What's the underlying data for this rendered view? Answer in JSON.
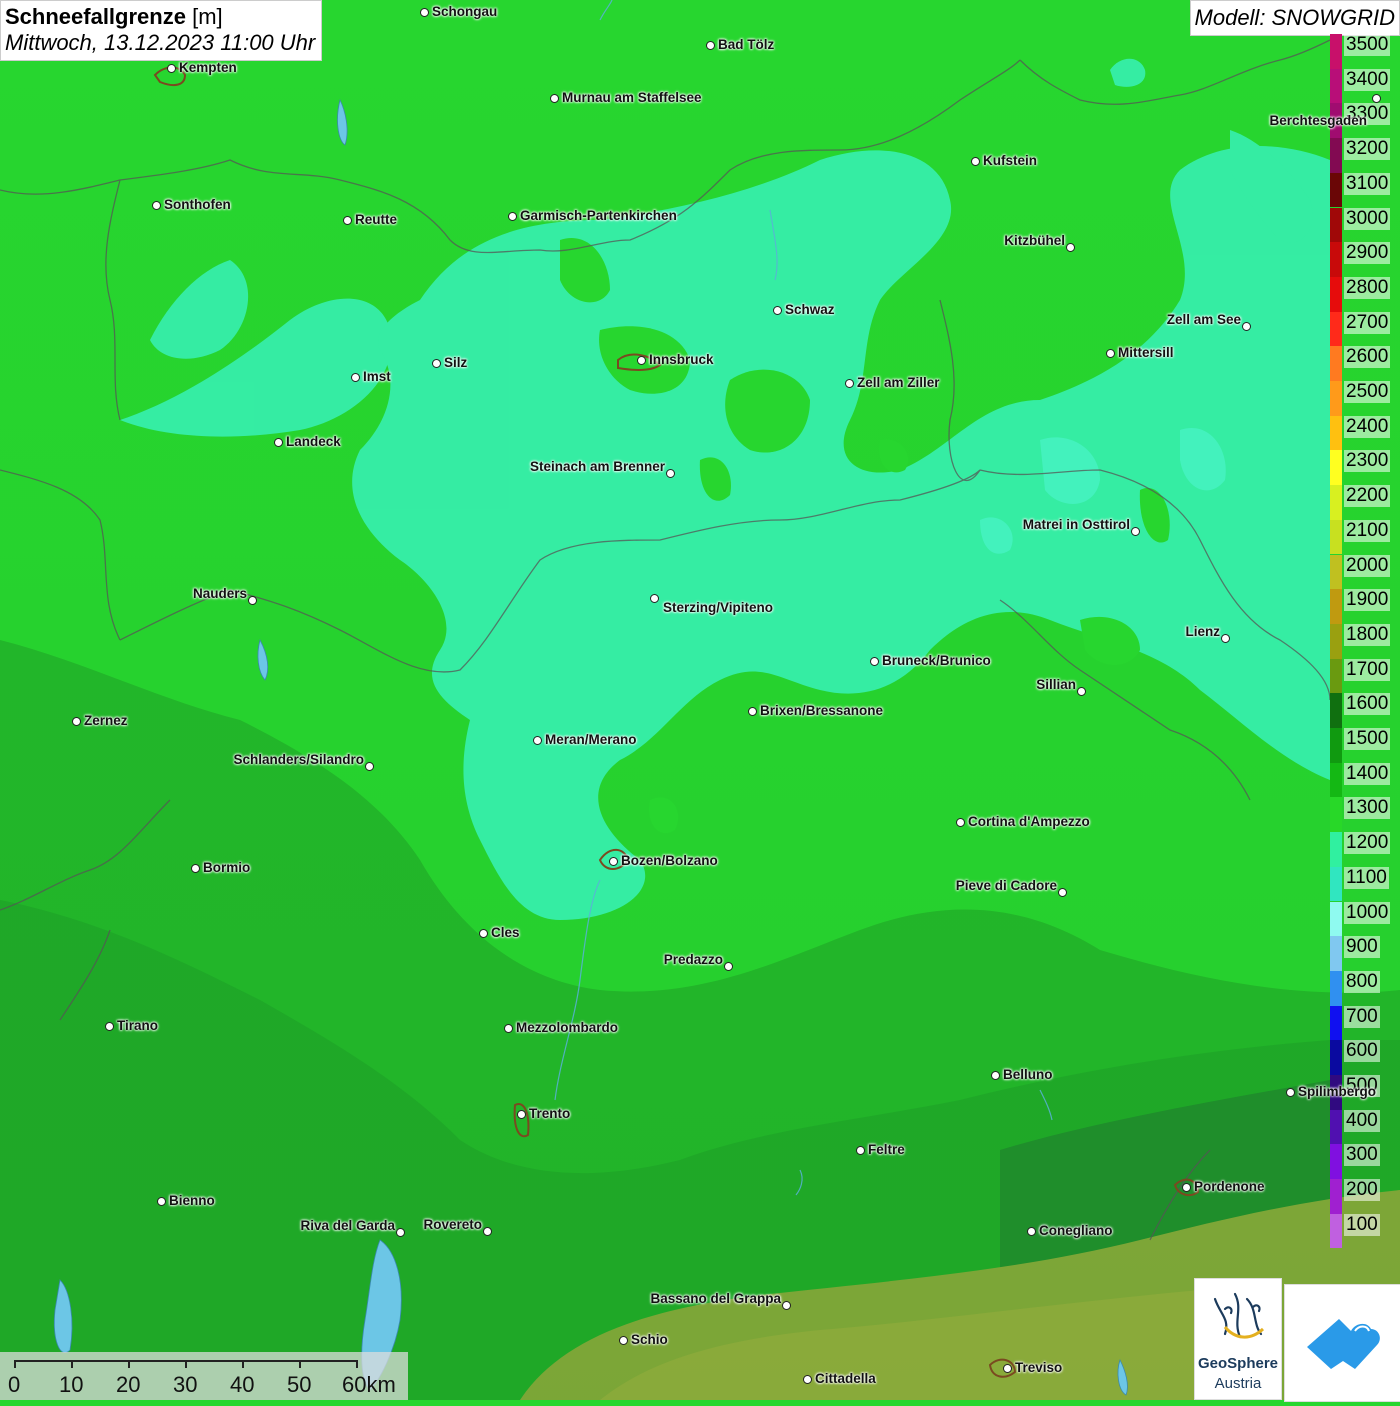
{
  "header": {
    "title_bold": "Schneefallgrenze",
    "title_unit": "[m]",
    "datetime": "Mittwoch, 13.12.2023 11:00 Uhr"
  },
  "model_label": "Modell: SNOWGRID",
  "legend": {
    "levels": [
      {
        "value": "3500",
        "color": "#c8106a"
      },
      {
        "value": "3400",
        "color": "#b80e78"
      },
      {
        "value": "3300",
        "color": "#a00c70"
      },
      {
        "value": "3200",
        "color": "#820a52"
      },
      {
        "value": "3100",
        "color": "#6a0606"
      },
      {
        "value": "3000",
        "color": "#a00808"
      },
      {
        "value": "2900",
        "color": "#c80a0a"
      },
      {
        "value": "2800",
        "color": "#e60c0c"
      },
      {
        "value": "2700",
        "color": "#ff2a1a"
      },
      {
        "value": "2600",
        "color": "#ff7a20"
      },
      {
        "value": "2500",
        "color": "#ff9a1a"
      },
      {
        "value": "2400",
        "color": "#ffc010"
      },
      {
        "value": "2300",
        "color": "#ffff20"
      },
      {
        "value": "2200",
        "color": "#d8f020"
      },
      {
        "value": "2100",
        "color": "#c8e020"
      },
      {
        "value": "2000",
        "color": "#c0c020"
      },
      {
        "value": "1900",
        "color": "#c09a10"
      },
      {
        "value": "1800",
        "color": "#9aa010"
      },
      {
        "value": "1700",
        "color": "#6a9a10"
      },
      {
        "value": "1600",
        "color": "#107010"
      },
      {
        "value": "1500",
        "color": "#109a10"
      },
      {
        "value": "1400",
        "color": "#14b814"
      },
      {
        "value": "1300",
        "color": "#28d828"
      },
      {
        "value": "1200",
        "color": "#30f0a0"
      },
      {
        "value": "1100",
        "color": "#30e6c0"
      },
      {
        "value": "1000",
        "color": "#8ffaf0"
      },
      {
        "value": "900",
        "color": "#80c8f0"
      },
      {
        "value": "800",
        "color": "#3090f0"
      },
      {
        "value": "700",
        "color": "#1010f0"
      },
      {
        "value": "600",
        "color": "#0a0aa0"
      },
      {
        "value": "500",
        "color": "#300a80"
      },
      {
        "value": "400",
        "color": "#5010b0"
      },
      {
        "value": "300",
        "color": "#8010e0"
      },
      {
        "value": "200",
        "color": "#a020d0"
      },
      {
        "value": "100",
        "color": "#c060e0"
      }
    ]
  },
  "cities": [
    {
      "name": "Schongau"
    },
    {
      "name": "Kempten"
    },
    {
      "name": "Bad Tölz"
    },
    {
      "name": "Murnau am Staffelsee"
    },
    {
      "name": "Berchtesgaden"
    },
    {
      "name": "Kufstein"
    },
    {
      "name": "Sonthofen"
    },
    {
      "name": "Reutte"
    },
    {
      "name": "Garmisch-Partenkirchen"
    },
    {
      "name": "Kitzbühel"
    },
    {
      "name": "Schwaz"
    },
    {
      "name": "Zell am See"
    },
    {
      "name": "Mittersill"
    },
    {
      "name": "Innsbruck"
    },
    {
      "name": "Imst"
    },
    {
      "name": "Silz"
    },
    {
      "name": "Zell am Ziller"
    },
    {
      "name": "Landeck"
    },
    {
      "name": "Steinach am Brenner"
    },
    {
      "name": "Matrei in Osttirol"
    },
    {
      "name": "Nauders"
    },
    {
      "name": "Sterzing/Vipiteno"
    },
    {
      "name": "Lienz"
    },
    {
      "name": "Bruneck/Brunico"
    },
    {
      "name": "Sillian"
    },
    {
      "name": "Brixen/Bressanone"
    },
    {
      "name": "Zernez"
    },
    {
      "name": "Meran/Merano"
    },
    {
      "name": "Schlanders/Silandro"
    },
    {
      "name": "Cortina d'Ampezzo"
    },
    {
      "name": "Bozen/Bolzano"
    },
    {
      "name": "Bormio"
    },
    {
      "name": "Pieve di Cadore"
    },
    {
      "name": "Cles"
    },
    {
      "name": "Predazzo"
    },
    {
      "name": "Tirano"
    },
    {
      "name": "Mezzolombardo"
    },
    {
      "name": "Belluno"
    },
    {
      "name": "Spilimbergo"
    },
    {
      "name": "Trento"
    },
    {
      "name": "Feltre"
    },
    {
      "name": "Pordenone"
    },
    {
      "name": "Bienno"
    },
    {
      "name": "Riva del Garda"
    },
    {
      "name": "Rovereto"
    },
    {
      "name": "Conegliano"
    },
    {
      "name": "Bassano del Grappa"
    },
    {
      "name": "Schio"
    },
    {
      "name": "Treviso"
    },
    {
      "name": "Cittadella"
    }
  ],
  "scalebar": {
    "labels": [
      "0",
      "10",
      "20",
      "30",
      "40",
      "50",
      "60km"
    ]
  },
  "logos": {
    "geosphere_line1": "GeoSphere",
    "geosphere_line2": "Austria"
  }
}
